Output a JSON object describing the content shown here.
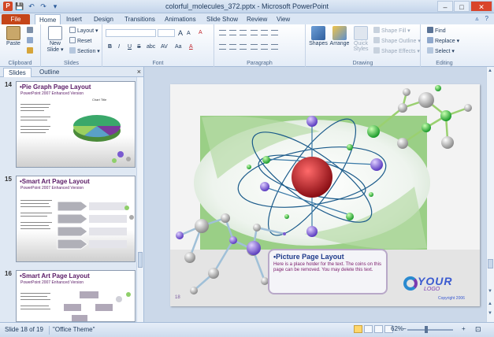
{
  "window": {
    "title": "colorful_molecules_372.pptx - Microsoft PowerPoint",
    "controls": {
      "minimize": "–",
      "maximize": "□",
      "close": "✕"
    }
  },
  "qat": {
    "app_icon": "P",
    "save_icon": "💾",
    "undo_icon": "↶",
    "redo_icon": "↷",
    "customize_icon": "▾"
  },
  "tabs": [
    "File",
    "Home",
    "Insert",
    "Design",
    "Transitions",
    "Animations",
    "Slide Show",
    "Review",
    "View"
  ],
  "ribbon": {
    "clipboard": {
      "label": "Clipboard",
      "paste": "Paste"
    },
    "slides": {
      "label": "Slides",
      "new_slide": "New Slide",
      "new_slide_dd": "▾",
      "layout": "Layout",
      "reset": "Reset",
      "section": "Section"
    },
    "font": {
      "label": "Font",
      "grow": "A",
      "shrink": "A",
      "clear": "A",
      "bold": "B",
      "italic": "I",
      "underline": "U",
      "strike": "S",
      "shadow": "abc",
      "spacing": "AV",
      "case": "Aa",
      "color": "A"
    },
    "paragraph": {
      "label": "Paragraph"
    },
    "drawing": {
      "label": "Drawing",
      "shapes": "Shapes",
      "arrange": "Arrange",
      "quick_styles": "Quick Styles",
      "shape_fill": "Shape Fill",
      "shape_outline": "Shape Outline",
      "shape_effects": "Shape Effects"
    },
    "editing": {
      "label": "Editing",
      "find": "Find",
      "replace": "Replace",
      "select": "Select"
    }
  },
  "left_panel": {
    "tabs": [
      "Slides",
      "Outline"
    ],
    "close": "×",
    "thumbnails": [
      {
        "number": "14",
        "title": "•Pie Graph Page Layout",
        "subtitle": "PowerPoint 2007 Enhanced Version",
        "chart_title": "Chart Title"
      },
      {
        "number": "15",
        "title": "•Smart Art Page Layout",
        "subtitle": "PowerPoint 2007 Enhanced Version"
      },
      {
        "number": "16",
        "title": "•Smart Art Page Layout",
        "subtitle": "PowerPoint 2007 Enhanced Version"
      }
    ]
  },
  "slide": {
    "box_title": "•Picture Page Layout",
    "box_text": "Here is a place holder for the text. The coins on this page can be removed.  You may delete this text.",
    "page_number": "18",
    "logo_main": "YOUR",
    "logo_sub": "LOGO",
    "copyright": "Copyright 2006"
  },
  "status": {
    "slide_info": "Slide 18 of 19",
    "theme": "\"Office Theme\"",
    "zoom": "62%",
    "zoom_minus": "−",
    "zoom_plus": "+",
    "fit": "⊡"
  },
  "colors": {
    "file_tab": "#c54519",
    "accent": "#2a5a9a",
    "slide_bg": "#f3f3f3",
    "nucleus": "#c0262d"
  }
}
